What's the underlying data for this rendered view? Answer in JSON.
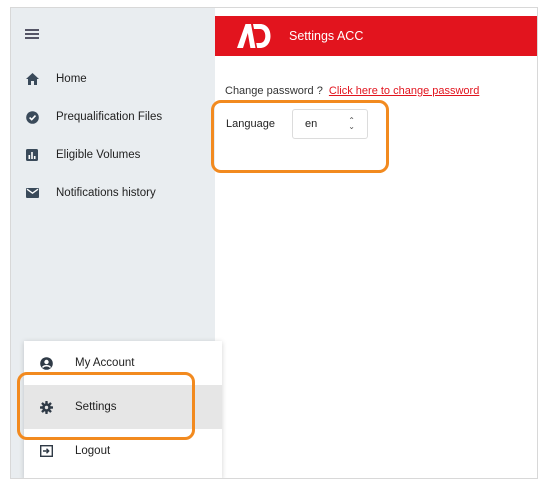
{
  "header": {
    "title": "Settings ACC",
    "logo_text": "AD",
    "brand_color": "#e2141e"
  },
  "sidebar": {
    "menu_icon": "hamburger-icon",
    "items": [
      {
        "label": "Home",
        "icon": "home-icon"
      },
      {
        "label": "Prequalification Files",
        "icon": "check-badge-icon"
      },
      {
        "label": "Eligible Volumes",
        "icon": "bar-chart-icon"
      },
      {
        "label": "Notifications history",
        "icon": "envelope-icon"
      }
    ]
  },
  "account_menu": {
    "items": [
      {
        "label": "My Account",
        "icon": "account-circle-icon"
      },
      {
        "label": "Settings",
        "icon": "gear-icon",
        "active": true
      },
      {
        "label": "Logout",
        "icon": "logout-icon"
      }
    ]
  },
  "main": {
    "password_prompt": "Change password ?",
    "password_link": "Click here to change password",
    "language_label": "Language",
    "language_value": "en"
  },
  "highlight_color": "#f28a1f"
}
